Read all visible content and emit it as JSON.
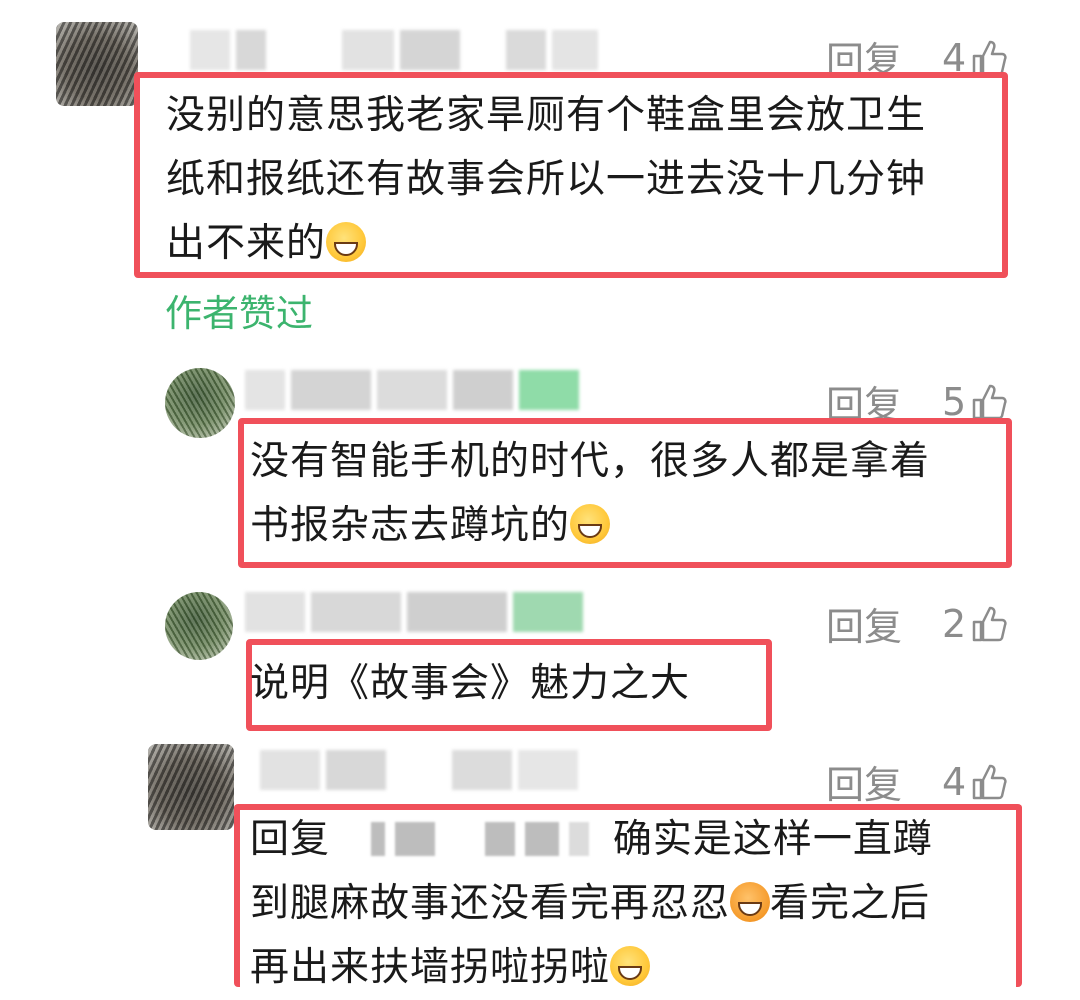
{
  "comments": [
    {
      "reply_label": "回复",
      "like_count": "4",
      "lines": [
        "没别的意思我老家旱厕有个鞋盒里会放卫生",
        "纸和报纸还有故事会所以一进去没十几分钟",
        "出不来的"
      ],
      "emoji": "grin-emoji",
      "author_liked": "作者赞过"
    },
    {
      "reply_label": "回复",
      "like_count": "5",
      "lines": [
        "没有智能手机的时代，很多人都是拿着",
        "书报杂志去蹲坑的"
      ],
      "emoji": "grin-emoji"
    },
    {
      "reply_label": "回复",
      "like_count": "2",
      "lines": [
        "说明《故事会》魅力之大"
      ]
    },
    {
      "reply_label": "回复",
      "like_count": "4",
      "prefix": "回复",
      "lines": [
        "确实是这样一直蹲",
        "到腿麻故事还没看完再忍忍",
        "看完之后",
        "再出来扶墙拐啦拐啦"
      ],
      "emojis": [
        "annoyed-emoji",
        "laugh-cry-emoji"
      ]
    }
  ],
  "colors": {
    "highlight_border": "#f0505a",
    "liked_text": "#3cb46e",
    "meta_text": "#8c8c8c"
  },
  "icons": [
    "thumb-up-icon"
  ]
}
